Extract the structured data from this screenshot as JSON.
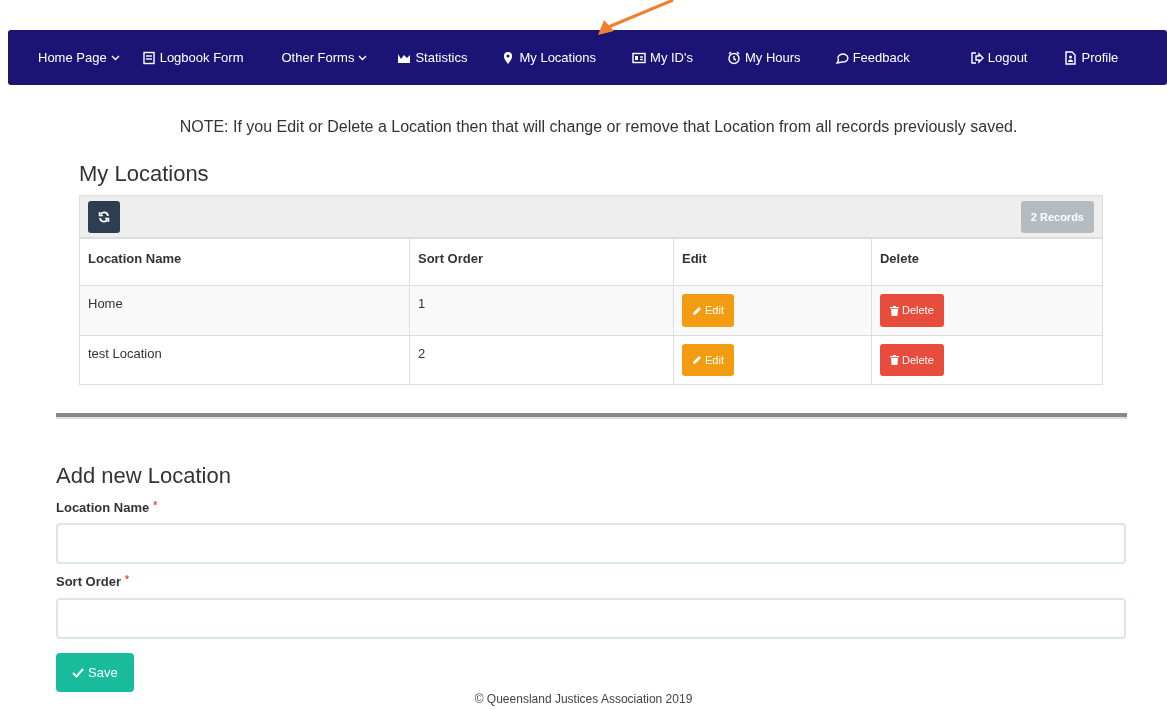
{
  "nav": [
    {
      "label": "Home Page",
      "kind": "dropdown",
      "dropdown": true
    },
    {
      "label": "Logbook Form",
      "kind": "form",
      "dropdown": false
    },
    {
      "label": "Other Forms",
      "kind": "dropdown",
      "dropdown": true
    },
    {
      "label": "Statistics",
      "kind": "chart",
      "dropdown": false
    },
    {
      "label": "My Locations",
      "kind": "pin",
      "dropdown": false
    },
    {
      "label": "My ID's",
      "kind": "id",
      "dropdown": false
    },
    {
      "label": "My Hours",
      "kind": "clock",
      "dropdown": false
    },
    {
      "label": "Feedback",
      "kind": "chat",
      "dropdown": false
    },
    {
      "label": "Logout",
      "kind": "logout",
      "dropdown": false
    },
    {
      "label": "Profile",
      "kind": "profile",
      "dropdown": false
    }
  ],
  "annotation_arrow": true,
  "note": "NOTE:  If you Edit or Delete a Location then that will change or remove that Location from all records previously saved.",
  "locations": {
    "title": "My Locations",
    "record_count": "2 Records",
    "columns": [
      "Location Name",
      "Sort Order",
      "Edit",
      "Delete"
    ],
    "rows": [
      {
        "name": "Home",
        "sort_order": "1",
        "edit": "Edit",
        "delete": "Delete"
      },
      {
        "name": "test Location",
        "sort_order": "2",
        "edit": "Edit",
        "delete": "Delete"
      }
    ]
  },
  "add_form": {
    "title": "Add new Location",
    "fields": [
      {
        "label": "Location Name",
        "required_mark": "*"
      },
      {
        "label": "Sort Order",
        "required_mark": "*"
      }
    ],
    "save": "Save"
  },
  "footer": "© Queensland Justices Association 2019"
}
